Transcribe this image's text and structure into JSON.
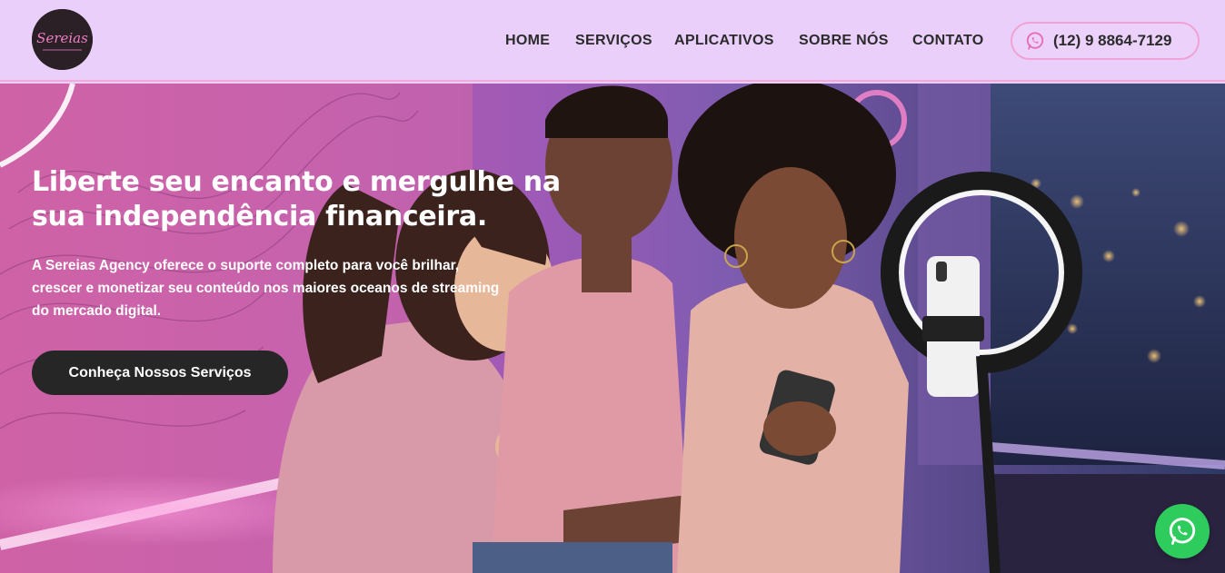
{
  "header": {
    "logo_text": "Sereias",
    "nav": [
      "HOME",
      "SERVIÇOS",
      "APLICATIVOS",
      "SOBRE NÓS",
      "CONTATO"
    ],
    "phone": "(12) 9 8864-7129",
    "phone_icon": "whatsapp-icon"
  },
  "hero": {
    "title": "Liberte seu encanto e mergulhe na sua independência financeira.",
    "description": "A Sereias Agency oferece o suporte completo para você brilhar, crescer e monetizar seu conteúdo nos maiores oceanos de streaming do mercado digital.",
    "cta_label": "Conheça Nossos Serviços"
  },
  "floating_button": {
    "icon": "whatsapp-icon"
  },
  "colors": {
    "header_bg": "#e9cffa",
    "accent_pink": "#f0a2d4",
    "cta_bg": "#262626",
    "whatsapp_green": "#2ecc5c"
  }
}
